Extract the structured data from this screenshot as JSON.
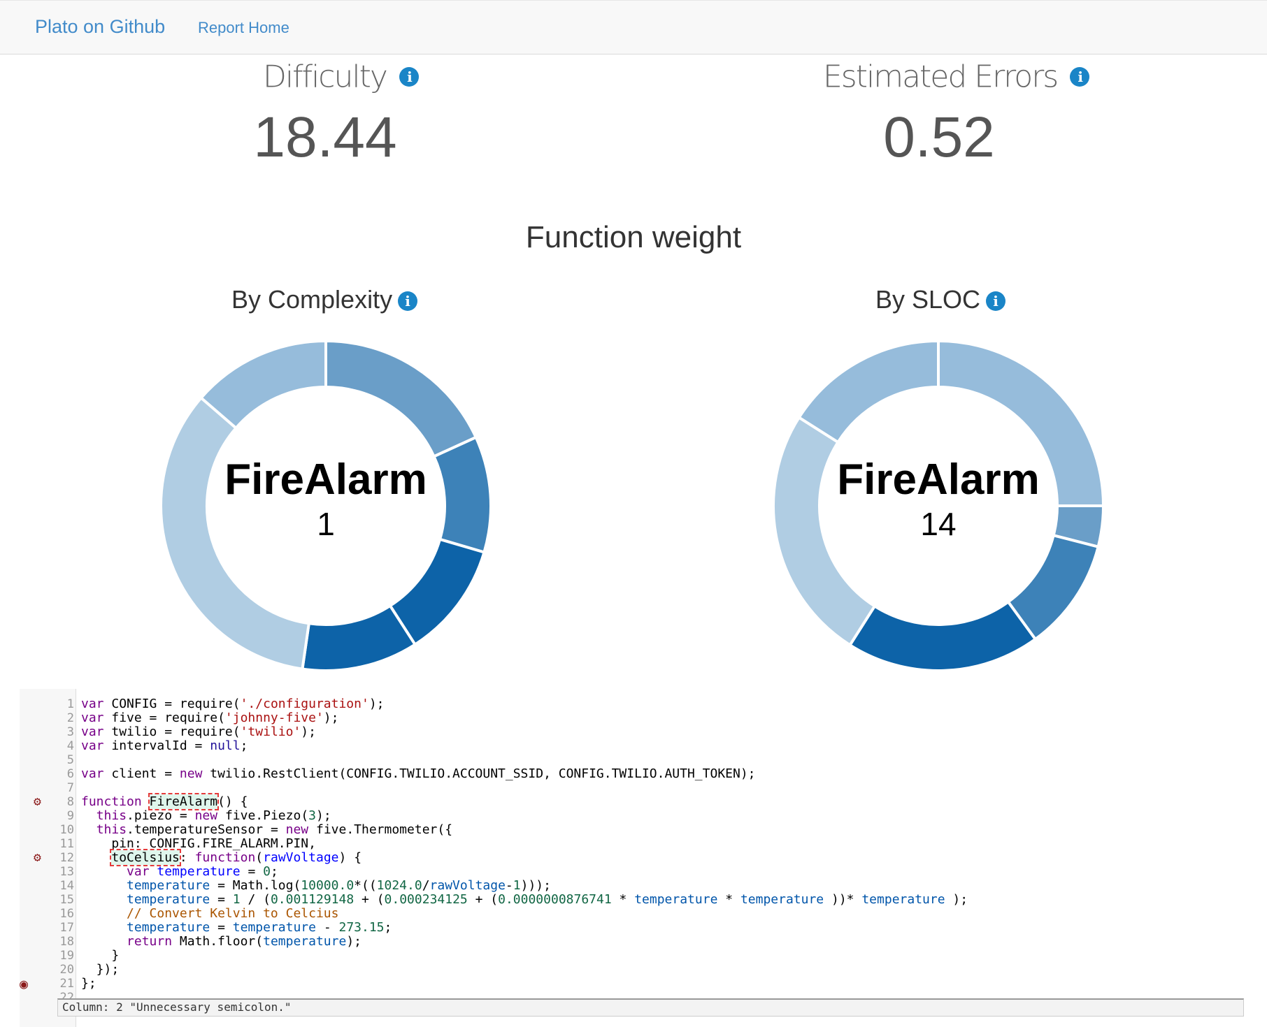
{
  "nav": {
    "brand": "Plato on Github",
    "link": "Report Home"
  },
  "stats": {
    "difficulty": {
      "label": "Difficulty",
      "value": "18.44"
    },
    "errors": {
      "label": "Estimated Errors",
      "value": "0.52"
    }
  },
  "section_title": "Function weight",
  "charts": {
    "complexity": {
      "title": "By Complexity",
      "center_name": "FireAlarm",
      "center_value": "1"
    },
    "sloc": {
      "title": "By SLOC",
      "center_name": "FireAlarm",
      "center_value": "14"
    }
  },
  "chart_data": [
    {
      "type": "pie",
      "title": "By Complexity",
      "values": [
        16,
        10,
        10,
        10,
        30,
        12
      ],
      "colors": [
        "#6a9ec8",
        "#3d82b8",
        "#0d63a8",
        "#0d63a8",
        "#b0cde3",
        "#96bcdb"
      ]
    },
    {
      "type": "pie",
      "title": "By SLOC",
      "values": [
        25,
        4,
        11,
        19,
        25,
        16
      ],
      "colors": [
        "#96bcdb",
        "#6a9ec8",
        "#3d82b8",
        "#0d63a8",
        "#b0cde3",
        "#96bcdb"
      ]
    }
  ],
  "code": {
    "lines": [
      {
        "n": "1",
        "html": "<span class=\"kw\">var</span> CONFIG = require(<span class=\"str\">'./configuration'</span>);"
      },
      {
        "n": "2",
        "html": "<span class=\"kw\">var</span> five = require(<span class=\"str\">'johnny-five'</span>);"
      },
      {
        "n": "3",
        "html": "<span class=\"kw\">var</span> twilio = require(<span class=\"str\">'twilio'</span>);"
      },
      {
        "n": "4",
        "html": "<span class=\"kw\">var</span> intervalId = <span class=\"atom\">null</span>;"
      },
      {
        "n": "5",
        "html": ""
      },
      {
        "n": "6",
        "html": "<span class=\"kw\">var</span> client = <span class=\"kw\">new</span> twilio.RestClient(CONFIG.TWILIO.ACCOUNT_SSID, CONFIG.TWILIO.AUTH_TOKEN);"
      },
      {
        "n": "7",
        "html": ""
      },
      {
        "n": "8",
        "html": "<span class=\"kw\">function</span> <span class=\"hl\">FireAlarm</span>() {"
      },
      {
        "n": "9",
        "html": "  <span class=\"kw\">this</span>.piezo = <span class=\"kw\">new</span> five.Piezo(<span class=\"num\">3</span>);"
      },
      {
        "n": "10",
        "html": "  <span class=\"kw\">this</span>.temperatureSensor = <span class=\"kw\">new</span> five.Thermometer({"
      },
      {
        "n": "11",
        "html": "    pin: CONFIG.FIRE_ALARM.PIN,"
      },
      {
        "n": "12",
        "html": "    <span class=\"hl\">toCelsius</span>: <span class=\"kw\">function</span>(<span class=\"def\">rawVoltage</span>) {"
      },
      {
        "n": "13",
        "html": "      <span class=\"kw\">var</span> <span class=\"def\">temperature</span> = <span class=\"num\">0</span>;"
      },
      {
        "n": "14",
        "html": "      <span class=\"var2\">temperature</span> = Math.log(<span class=\"num\">10000.0</span>*((<span class=\"num\">1024.0</span>/<span class=\"var2\">rawVoltage</span>-<span class=\"num\">1</span>)));"
      },
      {
        "n": "15",
        "html": "      <span class=\"var2\">temperature</span> = <span class=\"num\">1</span> / (<span class=\"num\">0.001129148</span> + (<span class=\"num\">0.000234125</span> + (<span class=\"num\">0.0000000876741</span> * <span class=\"var2\">temperature</span> * <span class=\"var2\">temperature</span> ))* <span class=\"var2\">temperature</span> );"
      },
      {
        "n": "16",
        "html": "      <span class=\"cmt\">// Convert Kelvin to Celcius</span>"
      },
      {
        "n": "17",
        "html": "      <span class=\"var2\">temperature</span> = <span class=\"var2\">temperature</span> - <span class=\"num\">273.15</span>;"
      },
      {
        "n": "18",
        "html": "      <span class=\"kw\">return</span> Math.floor(<span class=\"var2\">temperature</span>);"
      },
      {
        "n": "19",
        "html": "    }"
      },
      {
        "n": "20",
        "html": "  });"
      },
      {
        "n": "21",
        "html": "};"
      },
      {
        "n": "22",
        "html": ""
      }
    ],
    "lint_message": "Column: 2 \"Unnecessary semicolon.\""
  }
}
